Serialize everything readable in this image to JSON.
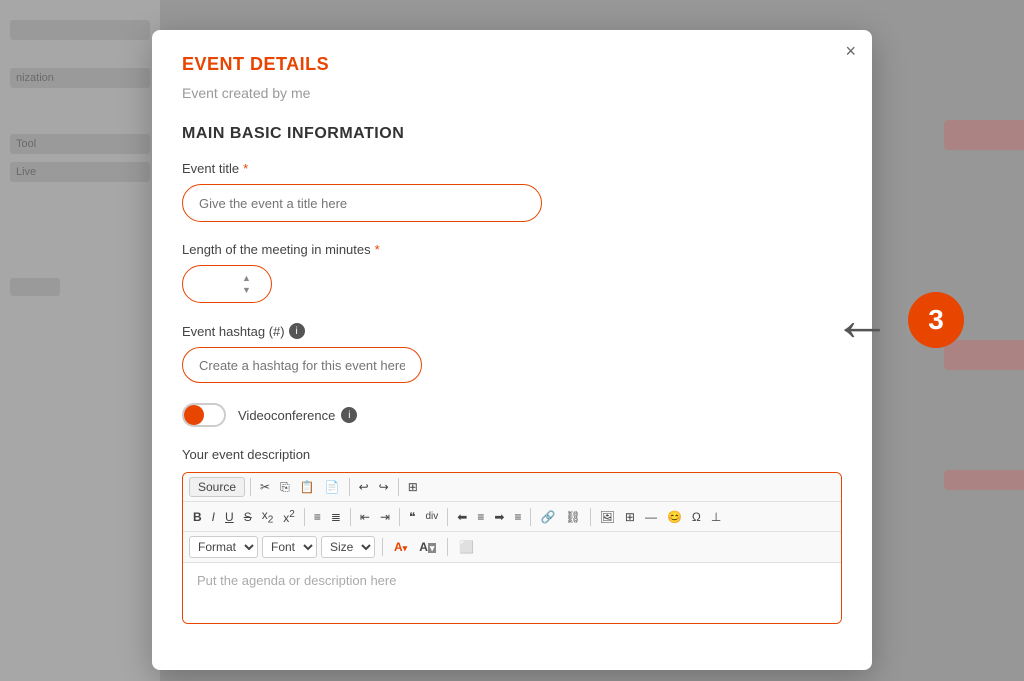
{
  "modal": {
    "title": "EVENT DETAILS",
    "close_label": "×",
    "subtitle": "Event created by me",
    "section_title": "MAIN BASIC INFORMATION",
    "fields": {
      "event_title": {
        "label": "Event title",
        "required": true,
        "placeholder": "Give the event a title here"
      },
      "meeting_length": {
        "label": "Length of the meeting in minutes",
        "required": true,
        "value": ""
      },
      "hashtag": {
        "label": "Event hashtag (#)",
        "placeholder": "Create a hashtag for this event here"
      },
      "videoconference": {
        "label": "Videoconference"
      },
      "description": {
        "label": "Your event description",
        "placeholder": "Put the agenda or description here"
      }
    },
    "toolbar": {
      "source_btn": "Source",
      "format_label": "Format",
      "font_label": "Font",
      "size_label": "Size",
      "buttons": {
        "cut": "✂",
        "copy": "⎘",
        "paste_text": "📋",
        "paste_word": "📄",
        "undo": "↩",
        "redo": "↪",
        "select_all": "⊞",
        "bold": "B",
        "italic": "I",
        "underline": "U",
        "strikethrough": "S",
        "subscript": "x₂",
        "superscript": "x²",
        "ol": "≡",
        "ul": "≣",
        "indent": "⇥",
        "outdent": "⇤",
        "blockquote": "❝",
        "div": "div",
        "align_left": "≡",
        "align_center": "≡",
        "align_right": "≡",
        "align_justify": "≡",
        "link": "🔗",
        "unlink": "⛓",
        "image": "🖼",
        "table": "⊞",
        "horiz_rule": "—",
        "smiley": "😊",
        "special_char": "Ω",
        "page_break": "⊥"
      }
    }
  },
  "arrow_badge": {
    "step": "3"
  }
}
